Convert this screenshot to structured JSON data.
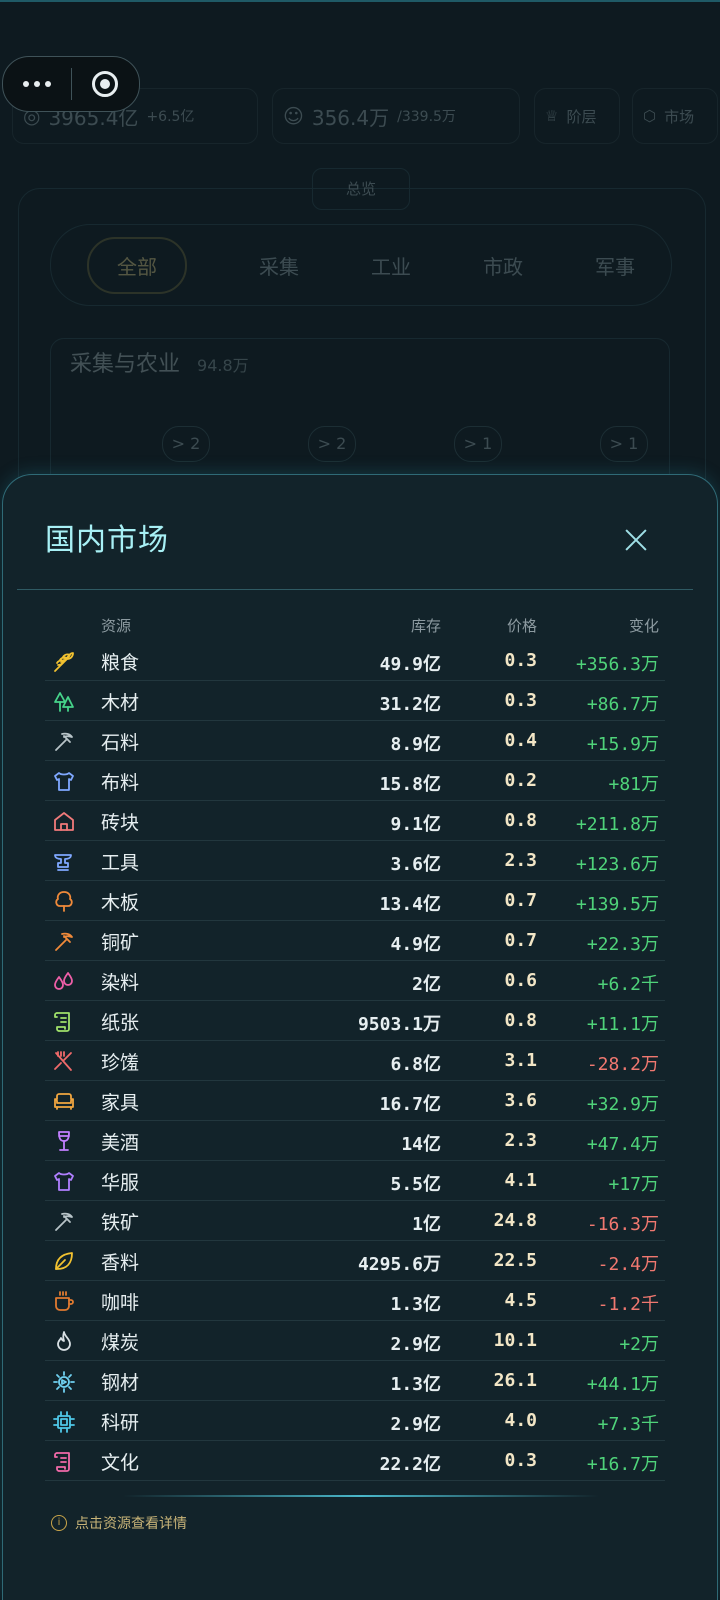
{
  "background": {
    "stats": [
      {
        "value": "3965.4亿",
        "delta": "+6.5亿"
      },
      {
        "value": "356.4万",
        "delta": "/339.5万"
      }
    ],
    "buttons": [
      "阶层",
      "市场"
    ],
    "overview_tab": "总览",
    "category_tabs": [
      "全部",
      "采集",
      "工业",
      "市政",
      "军事"
    ],
    "section_title": "采集与农业",
    "section_count": "94.8万",
    "mini_counters": [
      "> 2",
      "> 2",
      "> 1",
      "> 1"
    ]
  },
  "modal": {
    "title": "国内市场",
    "columns": {
      "name": "资源",
      "stock": "库存",
      "price": "价格",
      "change": "变化"
    },
    "rows": [
      {
        "icon": "wheat-icon",
        "color": "#f2c230",
        "name": "粮食",
        "stock": "49.9亿",
        "price": "0.3",
        "change": "+356.3万",
        "trend": "up"
      },
      {
        "icon": "trees-icon",
        "color": "#46d38a",
        "name": "木材",
        "stock": "31.2亿",
        "price": "0.3",
        "change": "+86.7万",
        "trend": "up"
      },
      {
        "icon": "pickaxe-icon",
        "color": "#b8c4c8",
        "name": "石料",
        "stock": "8.9亿",
        "price": "0.4",
        "change": "+15.9万",
        "trend": "up"
      },
      {
        "icon": "shirt-icon",
        "color": "#7fa8ff",
        "name": "布料",
        "stock": "15.8亿",
        "price": "0.2",
        "change": "+81万",
        "trend": "up"
      },
      {
        "icon": "house-icon",
        "color": "#f07a7a",
        "name": "砖块",
        "stock": "9.1亿",
        "price": "0.8",
        "change": "+211.8万",
        "trend": "up"
      },
      {
        "icon": "anvil-icon",
        "color": "#7fa8ff",
        "name": "工具",
        "stock": "3.6亿",
        "price": "2.3",
        "change": "+123.6万",
        "trend": "up"
      },
      {
        "icon": "tree-icon",
        "color": "#f08a3a",
        "name": "木板",
        "stock": "13.4亿",
        "price": "0.7",
        "change": "+139.5万",
        "trend": "up"
      },
      {
        "icon": "pickaxe-icon",
        "color": "#f08a3a",
        "name": "铜矿",
        "stock": "4.9亿",
        "price": "0.7",
        "change": "+22.3万",
        "trend": "up"
      },
      {
        "icon": "droplets-icon",
        "color": "#ee5fa8",
        "name": "染料",
        "stock": "2亿",
        "price": "0.6",
        "change": "+6.2千",
        "trend": "up"
      },
      {
        "icon": "scroll-icon",
        "color": "#9fe06a",
        "name": "纸张",
        "stock": "9503.1万",
        "price": "0.8",
        "change": "+11.1万",
        "trend": "up"
      },
      {
        "icon": "utensils-crossed-icon",
        "color": "#f06a6a",
        "name": "珍馐",
        "stock": "6.8亿",
        "price": "3.1",
        "change": "-28.2万",
        "trend": "down"
      },
      {
        "icon": "sofa-icon",
        "color": "#f0a640",
        "name": "家具",
        "stock": "16.7亿",
        "price": "3.6",
        "change": "+32.9万",
        "trend": "up"
      },
      {
        "icon": "wine-icon",
        "color": "#c27fff",
        "name": "美酒",
        "stock": "14亿",
        "price": "2.3",
        "change": "+47.4万",
        "trend": "up"
      },
      {
        "icon": "shirt-icon",
        "color": "#b07fff",
        "name": "华服",
        "stock": "5.5亿",
        "price": "4.1",
        "change": "+17万",
        "trend": "up"
      },
      {
        "icon": "pickaxe-icon",
        "color": "#b8c4c8",
        "name": "铁矿",
        "stock": "1亿",
        "price": "24.8",
        "change": "-16.3万",
        "trend": "down"
      },
      {
        "icon": "leaf-icon",
        "color": "#f2c230",
        "name": "香料",
        "stock": "4295.6万",
        "price": "22.5",
        "change": "-2.4万",
        "trend": "down"
      },
      {
        "icon": "coffee-icon",
        "color": "#e07a30",
        "name": "咖啡",
        "stock": "1.3亿",
        "price": "4.5",
        "change": "-1.2千",
        "trend": "down"
      },
      {
        "icon": "flame-icon",
        "color": "#d8e0e4",
        "name": "煤炭",
        "stock": "2.9亿",
        "price": "10.1",
        "change": "+2万",
        "trend": "up"
      },
      {
        "icon": "cog-icon",
        "color": "#6fd0f0",
        "name": "钢材",
        "stock": "1.3亿",
        "price": "26.1",
        "change": "+44.1万",
        "trend": "up"
      },
      {
        "icon": "cpu-icon",
        "color": "#4fc8e8",
        "name": "科研",
        "stock": "2.9亿",
        "price": "4.0",
        "change": "+7.3千",
        "trend": "up"
      },
      {
        "icon": "scroll-icon",
        "color": "#f06aa8",
        "name": "文化",
        "stock": "22.2亿",
        "price": "0.3",
        "change": "+16.7万",
        "trend": "up"
      }
    ],
    "hint": "点击资源查看详情",
    "colors": {
      "up": "#4fd37a",
      "down": "#f07870",
      "accent": "#a8f0f5"
    }
  }
}
